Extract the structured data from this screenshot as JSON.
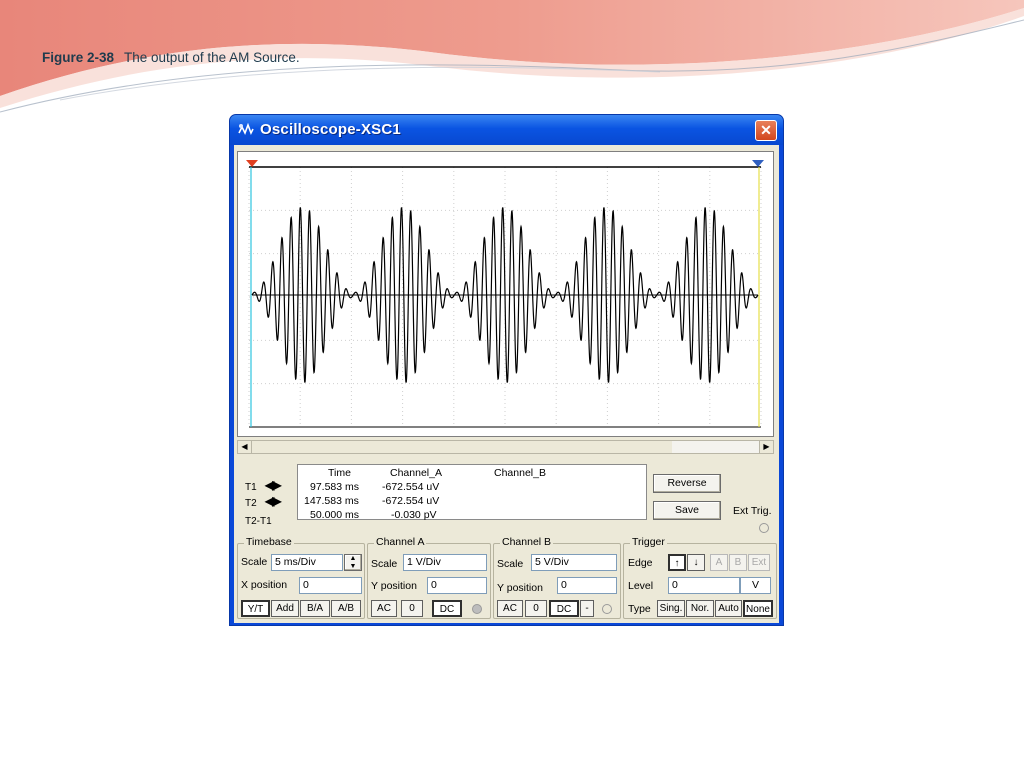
{
  "caption": {
    "figure": "Figure 2-38",
    "text": "The output of the AM Source."
  },
  "window": {
    "title": "Oscilloscope-XSC1",
    "close_glyph": "✕",
    "accent": "#0a54e2",
    "close_color": "#d2461e"
  },
  "screen": {
    "trace_color": "#000000",
    "cursor1_color": "#2ec4e0",
    "cursor2_color": "#e6e04a",
    "marker1_color": "#e04020",
    "marker2_color": "#3060c0",
    "time_axis_ms": [
      0,
      50
    ],
    "envelope_period_ms": 10,
    "carrier_cycles_per_envelope": 11,
    "modulation_index": 0.95
  },
  "readout": {
    "t1_label": "T1",
    "t2_label": "T2",
    "t2t1_label": "T2-T1",
    "headers": {
      "time": "Time",
      "channel_a": "Channel_A",
      "channel_b": "Channel_B"
    },
    "rows": [
      {
        "time": "97.583 ms",
        "channel_a": "-672.554 uV",
        "channel_b": ""
      },
      {
        "time": "147.583 ms",
        "channel_a": "-672.554 uV",
        "channel_b": ""
      },
      {
        "time": "50.000 ms",
        "channel_a": "-0.030 pV",
        "channel_b": ""
      }
    ],
    "reverse_label": "Reverse",
    "save_label": "Save",
    "ext_trig_label": "Ext Trig."
  },
  "timebase": {
    "title": "Timebase",
    "scale_label": "Scale",
    "scale_value": "5 ms/Div",
    "xpos_label": "X position",
    "xpos_value": "0",
    "modes": [
      "Y/T",
      "Add",
      "B/A",
      "A/B"
    ]
  },
  "channel_a": {
    "title": "Channel A",
    "scale_label": "Scale",
    "scale_value": "1  V/Div",
    "ypos_label": "Y position",
    "ypos_value": "0",
    "coupling": [
      "AC",
      "0",
      "DC"
    ]
  },
  "channel_b": {
    "title": "Channel B",
    "scale_label": "Scale",
    "scale_value": "5  V/Div",
    "ypos_label": "Y position",
    "ypos_value": "0",
    "coupling": [
      "AC",
      "0",
      "DC",
      "-"
    ]
  },
  "trigger": {
    "title": "Trigger",
    "edge_label": "Edge",
    "sources": [
      "A",
      "B",
      "Ext"
    ],
    "level_label": "Level",
    "level_value": "0",
    "level_unit": "V",
    "type_label": "Type",
    "types": [
      "Sing.",
      "Nor.",
      "Auto",
      "None"
    ]
  }
}
